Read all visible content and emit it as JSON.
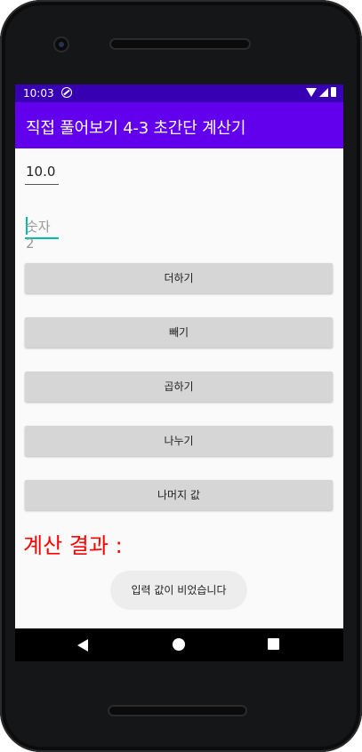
{
  "status_bar": {
    "time": "10:03"
  },
  "app_bar": {
    "title": "직접 풀어보기 4-3 초간단 계산기"
  },
  "inputs": {
    "number1_value": "10.0",
    "number2_placeholder": "숫자2"
  },
  "buttons": {
    "add": "더하기",
    "subtract": "빼기",
    "multiply": "곱하기",
    "divide": "나누기",
    "remainder": "나머지 값"
  },
  "result": {
    "label": "계산 결과 :",
    "color": "#ff0000"
  },
  "toast": {
    "message": "입력 값이 비었습니다"
  },
  "nav_bar": {
    "icons": [
      "back-icon",
      "home-icon",
      "recents-icon"
    ]
  },
  "colors": {
    "status_bar": "#3700b3",
    "app_bar": "#6200ee",
    "accent": "#00bfa5",
    "button": "#d6d6d6"
  }
}
